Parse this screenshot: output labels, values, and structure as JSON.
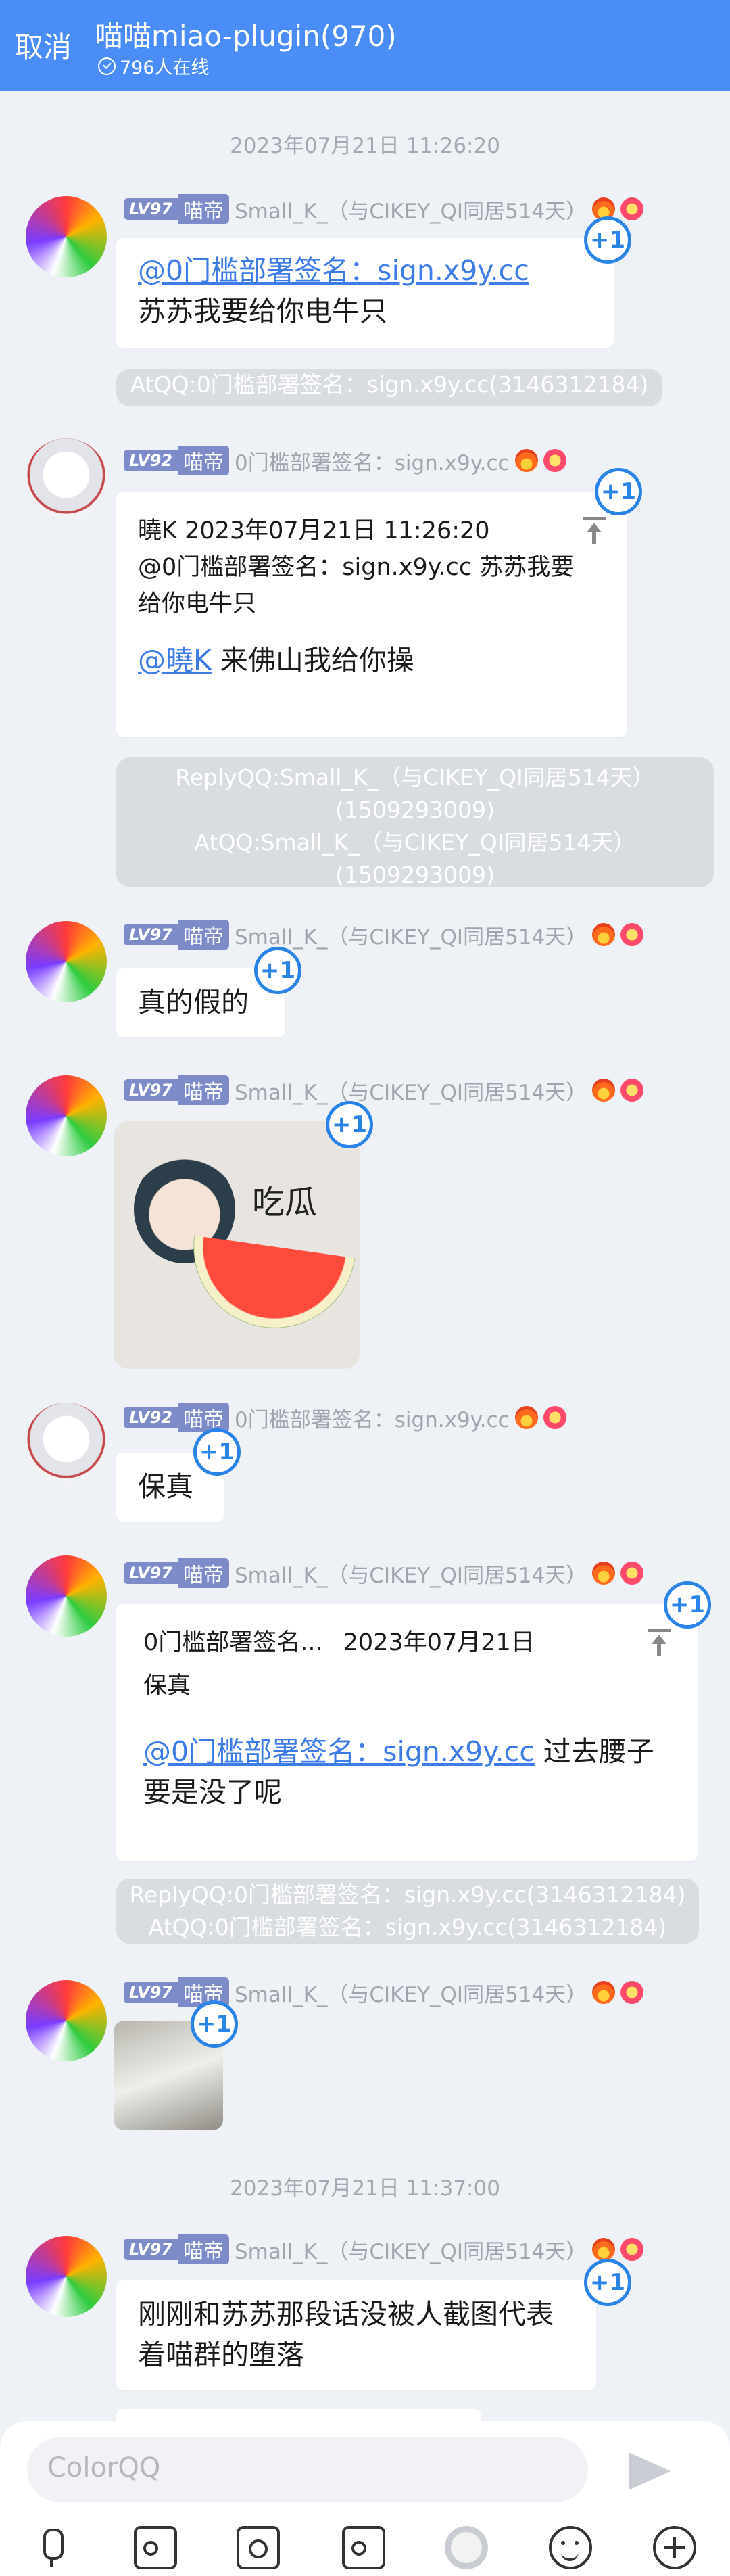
{
  "header": {
    "cancel_label": "取消",
    "title": "喵喵miao-plugin(970)",
    "online": "796人在线"
  },
  "timestamps": [
    "2023年07月21日 11:26:20",
    "2023年07月21日 11:37:00"
  ],
  "users": {
    "small": {
      "level": "LV97",
      "role": "喵帝",
      "nick": "Small_K_（与CIKEY_QI同居514天）"
    },
    "gate": {
      "level": "LV92",
      "role": "喵帝",
      "nick": "0门槛部署签名：sign.x9y.cc"
    }
  },
  "plus_one": "+1",
  "messages": {
    "m1": {
      "mention": "@0门槛部署签名：sign.x9y.cc",
      "text": "苏苏我要给你电牛只"
    },
    "sys1": "AtQQ:0门槛部署签名：sign.x9y.cc(3146312184)",
    "m2": {
      "quote_author_time": "曉K 2023年07月21日 11:26:20",
      "quote_text": "@0门槛部署签名：sign.x9y.cc 苏苏我要给你电牛只",
      "mention": "@曉K",
      "text": " 来佛山我给你操"
    },
    "sys2": [
      "ReplyQQ:Small_K_（与CIKEY_QI同居514天）(1509293009)",
      "AtQQ:Small_K_（与CIKEY_QI同居514天）(1509293009)"
    ],
    "m3": {
      "text": "真的假的"
    },
    "m4": {
      "sticker_text": "吃瓜"
    },
    "m5": {
      "text": "保真"
    },
    "m6": {
      "quote_author": "0门槛部署签名...",
      "quote_time": "2023年07月21日",
      "quote_text": "保真",
      "mention": "@0门槛部署签名：sign.x9y.cc",
      "text": " 过去腰子要是没了呢"
    },
    "sys3": [
      "ReplyQQ:0门槛部署签名：sign.x9y.cc(3146312184)",
      "AtQQ:0门槛部署签名：sign.x9y.cc(3146312184)"
    ],
    "m8": {
      "text": "刚刚和苏苏那段话没被人截图代表着喵群的堕落"
    }
  },
  "input": {
    "placeholder": "ColorQQ"
  },
  "icons": [
    "mic-icon",
    "image-icon",
    "camera-icon",
    "file-icon",
    "gif-icon",
    "emoji-icon",
    "plus-icon",
    "send-icon"
  ],
  "colors": {
    "header": "#4b8df8",
    "link": "#3d7be6",
    "plus": "#2a84e8"
  }
}
